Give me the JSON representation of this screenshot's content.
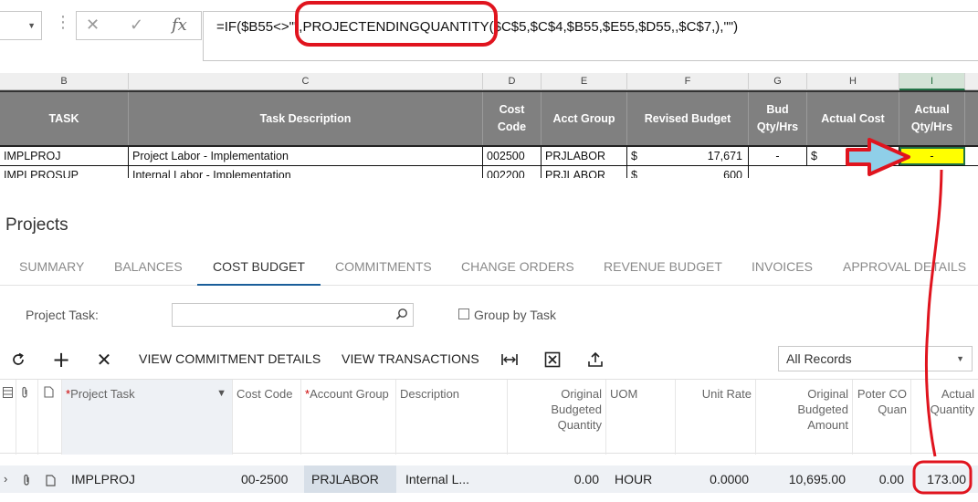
{
  "excel": {
    "formula": "=IF($B55<>\"\",PROJECTENDINGQUANTITY($C$5,$C$4,$B55,$E55,$D55,,$C$7,),\"\")",
    "column_letters": [
      "B",
      "C",
      "D",
      "E",
      "F",
      "G",
      "H",
      "I"
    ],
    "headers": [
      "TASK",
      "Task Description",
      "Cost Code",
      "Acct Group",
      "Revised Budget",
      "Bud Qty/Hrs",
      "Actual Cost",
      "Actual Qty/Hrs"
    ],
    "row1": {
      "task": "IMPLPROJ",
      "description": "Project Labor - Implementation",
      "cost_code": "002500",
      "acct_group": "PRJLABOR",
      "currency": "$",
      "revised_budget": "17,671",
      "bud_qty": "-",
      "actual_cost_currency": "$",
      "actual_qty": "-"
    },
    "row2": {
      "task": "IMPLPROSUP",
      "description": "Internal Labor - Implementation",
      "cost_code": "002200",
      "acct_group": "PRJLABOR",
      "currency": "$",
      "revised_budget": "600"
    }
  },
  "acumatica": {
    "page_title": "Projects",
    "tabs": [
      "SUMMARY",
      "BALANCES",
      "COST BUDGET",
      "COMMITMENTS",
      "CHANGE ORDERS",
      "REVENUE BUDGET",
      "INVOICES",
      "APPROVAL DETAILS"
    ],
    "active_tab": "COST BUDGET",
    "filter": {
      "project_task_label": "Project Task:",
      "project_task_value": "",
      "group_by_task_label": "Group by Task"
    },
    "toolbar": {
      "view_commitment_details": "VIEW COMMITMENT DETAILS",
      "view_transactions": "VIEW TRANSACTIONS",
      "records_filter": "All Records"
    },
    "grid_headers": {
      "project_task": "Project Task",
      "cost_code": "Cost Code",
      "account_group": "Account Group",
      "description": "Description",
      "original_budgeted_quantity": "Original Budgeted Quantity",
      "uom": "UOM",
      "unit_rate": "Unit Rate",
      "original_budgeted_amount": "Original Budgeted Amount",
      "potential_co_quantity": "Poter CO Quan",
      "actual_quantity": "Actual Quantity"
    },
    "row": {
      "project_task": "IMPLPROJ",
      "cost_code": "00-2500",
      "account_group": "PRJLABOR",
      "description": "Internal L...",
      "original_budgeted_quantity": "0.00",
      "uom": "HOUR",
      "unit_rate": "0.0000",
      "original_budgeted_amount": "10,695.00",
      "potential_co_quantity": "0.00",
      "actual_quantity": "173.00"
    }
  },
  "colors": {
    "annotation_red": "#e0141e",
    "arrow_fill": "#8fcfe8",
    "excel_header_gray": "#808080",
    "excel_selected_cell": "#ffff00",
    "acumatica_tab_underline": "#1a5e9a"
  }
}
